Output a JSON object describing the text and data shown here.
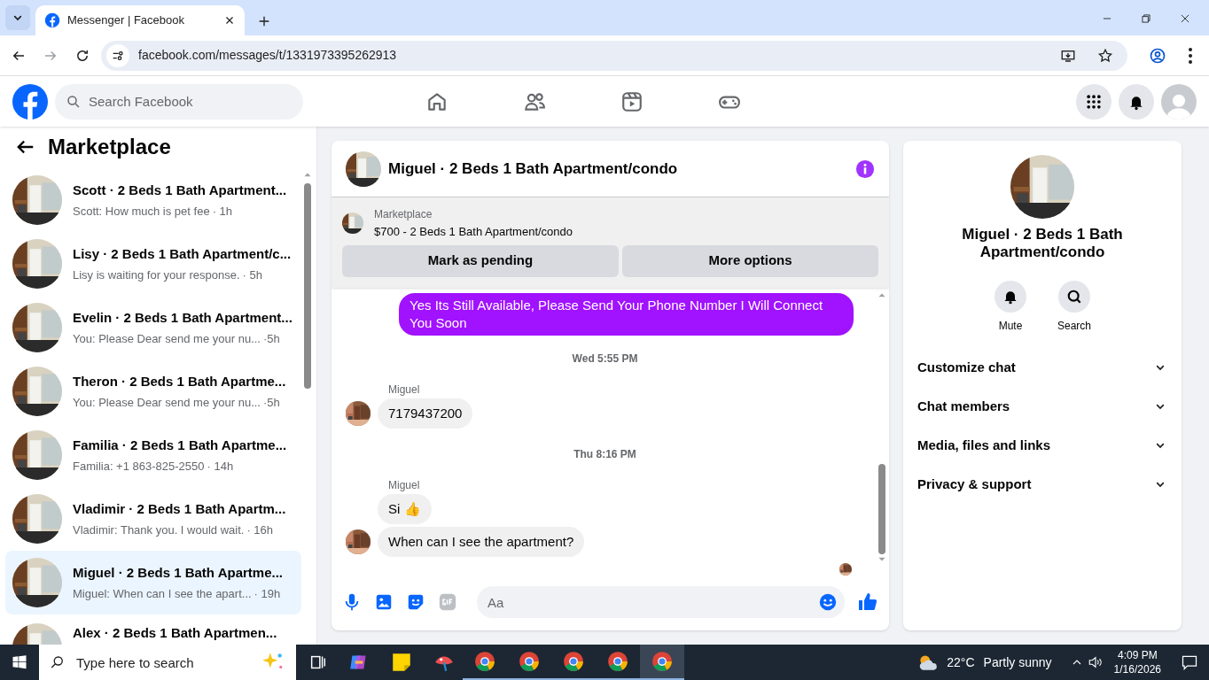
{
  "browser": {
    "tab_title": "Messenger | Facebook",
    "url": "facebook.com/messages/t/1331973395262913"
  },
  "facebook": {
    "search_placeholder": "Search Facebook"
  },
  "sidebar": {
    "title": "Marketplace",
    "conversations": [
      {
        "title": "Scott · 2 Beds 1 Bath Apartment...",
        "preview": "Scott: How much is pet fee",
        "time": "· 1h",
        "selected": false
      },
      {
        "title": "Lisy · 2 Beds 1 Bath Apartment/c...",
        "preview": "Lisy is waiting for your response.",
        "time": "· 5h",
        "selected": false
      },
      {
        "title": "Evelin · 2 Beds 1 Bath Apartment...",
        "preview": "You: Please Dear send me your nu...",
        "time": "·5h",
        "selected": false
      },
      {
        "title": "Theron · 2 Beds 1 Bath Apartme...",
        "preview": "You: Please Dear send me your nu...",
        "time": "·5h",
        "selected": false
      },
      {
        "title": "Familia · 2 Beds 1 Bath Apartme...",
        "preview": "Familia: +1 863-825-2550",
        "time": "· 14h",
        "selected": false
      },
      {
        "title": "Vladimir · 2 Beds 1 Bath Apartm...",
        "preview": "Vladimir: Thank you. I would wait.",
        "time": "· 16h",
        "selected": false
      },
      {
        "title": "Miguel · 2 Beds 1 Bath Apartme...",
        "preview": "Miguel: When can I see the apart...",
        "time": "· 19h",
        "selected": true
      },
      {
        "title": "Alex · 2 Beds 1 Bath Apartmen..."
      }
    ]
  },
  "chat": {
    "title": "Miguel · 2 Beds 1 Bath Apartment/condo",
    "listing": {
      "label": "Marketplace",
      "item": "$700 - 2 Beds 1 Bath Apartment/condo"
    },
    "buttons": [
      "Mark as pending",
      "More options"
    ],
    "messages": [
      {
        "kind": "outgoing",
        "text": "Yes Its Still Available, Please Send Your Phone Number I Will Connect You Soon"
      },
      {
        "kind": "time",
        "text": "Wed 5:55 PM"
      },
      {
        "kind": "incoming",
        "sender": "Miguel",
        "texts": [
          "7179437200"
        ]
      },
      {
        "kind": "time",
        "text": "Thu 8:16 PM"
      },
      {
        "kind": "incoming",
        "sender": "Miguel",
        "texts": [
          "Si 👍",
          "When can I see the apartment?"
        ]
      }
    ],
    "composer_placeholder": "Aa"
  },
  "details": {
    "name": "Miguel · 2 Beds 1 Bath Apartment/condo",
    "actions": [
      {
        "kind": "mute",
        "label": "Mute"
      },
      {
        "kind": "search",
        "label": "Search"
      }
    ],
    "sections": [
      "Customize chat",
      "Chat members",
      "Media, files and links",
      "Privacy & support"
    ]
  },
  "taskbar": {
    "search_placeholder": "Type here to search",
    "temperature": "22°C",
    "weather": "Partly sunny",
    "time": "4:09 PM",
    "date": "1/16/2026"
  }
}
